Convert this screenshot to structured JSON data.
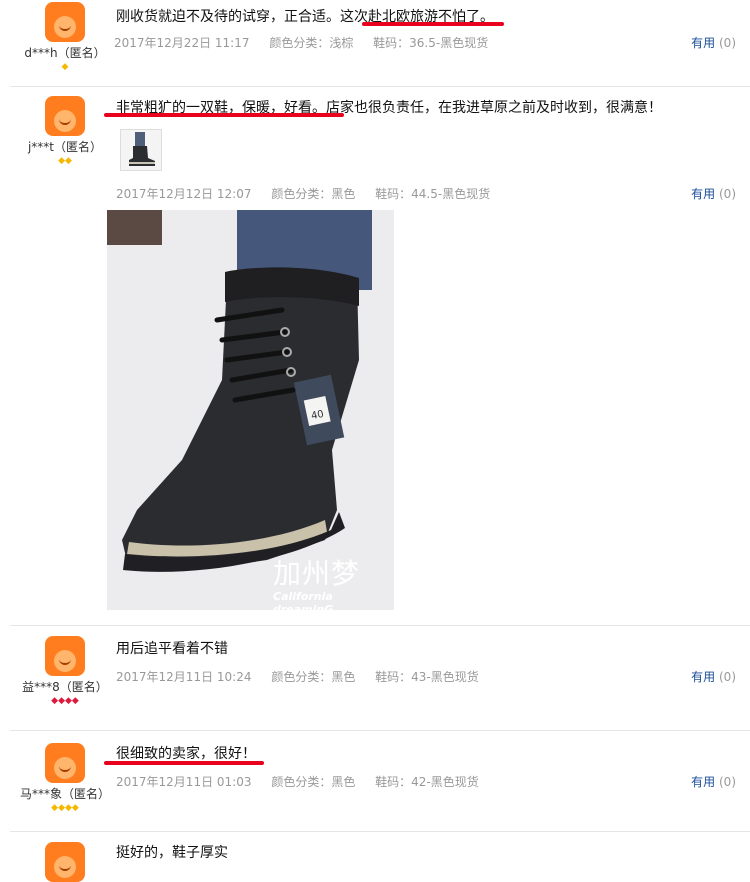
{
  "reviews": [
    {
      "user": "d***h（匿名）",
      "text": "刚收货就迫不及待的试穿，正合适。这次赴北欧旅游不怕了。",
      "date": "2017年12月22日 11:17",
      "color": "颜色分类：浅棕",
      "size": "鞋码：36.5-黑色现货",
      "useful": "有用",
      "count": "(0)"
    },
    {
      "user": "j***t（匿名）",
      "text": "非常粗犷的一双鞋，保暖，好看。店家也很负责任，在我进草原之前及时收到，很满意！",
      "date": "2017年12月12日 12:07",
      "color": "颜色分类：黑色",
      "size": "鞋码：44.5-黑色现货",
      "useful": "有用",
      "count": "(0)",
      "photo_watermark": "加州梦",
      "photo_caption": "California dreaminG",
      "tag_text": "40"
    },
    {
      "user": "益***8（匿名）",
      "text": "用后追平看着不错",
      "date": "2017年12月11日 10:24",
      "color": "颜色分类：黑色",
      "size": "鞋码：43-黑色现货",
      "useful": "有用",
      "count": "(0)"
    },
    {
      "user": "马***象（匿名）",
      "text": "很细致的卖家，很好！",
      "date": "2017年12月11日 01:03",
      "color": "颜色分类：黑色",
      "size": "鞋码：42-黑色现货",
      "useful": "有用",
      "count": "(0)"
    },
    {
      "text": "挺好的，鞋子厚实"
    }
  ],
  "colors": {
    "highlight": "#e8001c",
    "link": "#1a4d99",
    "avatar": "#ff7d1e"
  }
}
